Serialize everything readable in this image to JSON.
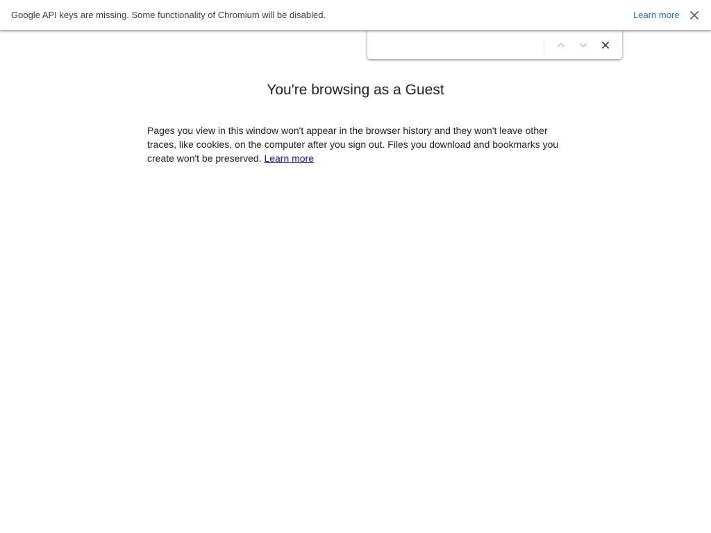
{
  "infobar": {
    "message": "Google API keys are missing. Some functionality of Chromium will be disabled.",
    "link_label": "Learn more",
    "close_icon": "close-icon"
  },
  "findbar": {
    "query": "",
    "match_count": "",
    "prev_icon": "chevron-up-icon",
    "next_icon": "chevron-down-icon",
    "close_icon": "close-icon"
  },
  "guest_page": {
    "title": "You're browsing as a Guest",
    "description": "Pages you view in this window won't appear in the browser history and they won't leave other traces, like cookies, on the computer after you sign out. Files you download and bookmarks you create won't be preserved.",
    "link_label": "Learn more"
  },
  "colors": {
    "link_blue": "#1a73e8",
    "body_link": "#1a0dab",
    "text": "#202124"
  }
}
